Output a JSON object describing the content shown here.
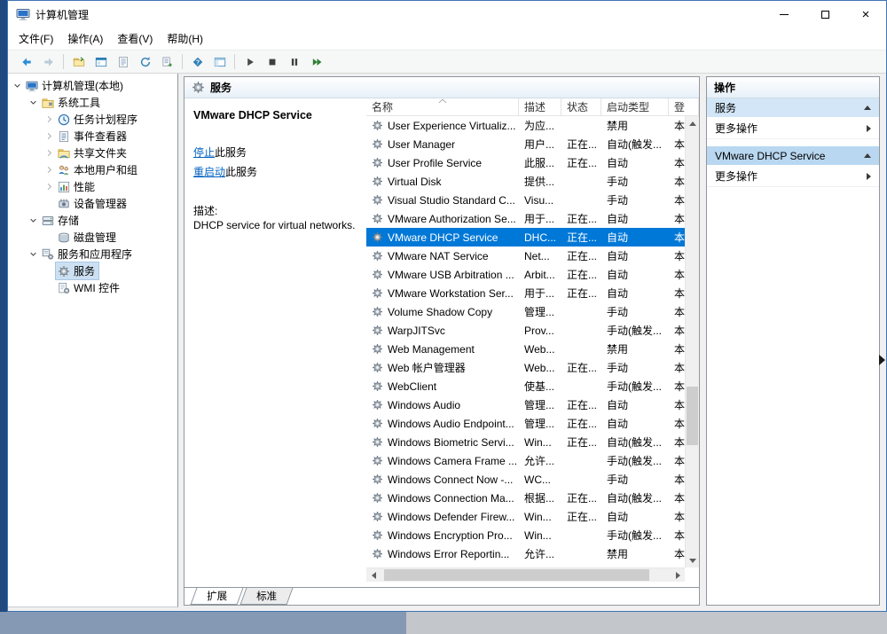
{
  "window": {
    "title": "计算机管理"
  },
  "menubar": {
    "items": [
      "文件(F)",
      "操作(A)",
      "查看(V)",
      "帮助(H)"
    ]
  },
  "toolbar": {
    "buttons": [
      {
        "name": "back",
        "icon": "back-icon"
      },
      {
        "name": "forward",
        "icon": "forward-icon"
      },
      {
        "type": "separator"
      },
      {
        "name": "export",
        "icon": "folder-icon"
      },
      {
        "name": "console-window",
        "icon": "console-window-icon"
      },
      {
        "name": "properties",
        "icon": "properties-icon"
      },
      {
        "name": "refresh",
        "icon": "refresh-icon"
      },
      {
        "name": "export-list",
        "icon": "export-list-icon"
      },
      {
        "type": "separator"
      },
      {
        "name": "help",
        "icon": "help-icon"
      },
      {
        "name": "show-console-tree",
        "icon": "console-tree-icon"
      },
      {
        "type": "separator"
      },
      {
        "name": "start-service",
        "icon": "start-service-icon"
      },
      {
        "name": "stop-service",
        "icon": "stop-service-icon"
      },
      {
        "name": "pause-service",
        "icon": "pause-service-icon"
      },
      {
        "name": "restart-service",
        "icon": "restart-service-icon"
      }
    ]
  },
  "tree": {
    "items": [
      {
        "label": "计算机管理(本地)",
        "level": 0,
        "chevron": "expanded",
        "icon": "computer-icon",
        "selected": false
      },
      {
        "label": "系统工具",
        "level": 1,
        "chevron": "expanded",
        "icon": "system-tools-icon",
        "selected": false
      },
      {
        "label": "任务计划程序",
        "level": 2,
        "chevron": "collapsed",
        "icon": "task-scheduler-icon",
        "selected": false
      },
      {
        "label": "事件查看器",
        "level": 2,
        "chevron": "collapsed",
        "icon": "event-viewer-icon",
        "selected": false
      },
      {
        "label": "共享文件夹",
        "level": 2,
        "chevron": "collapsed",
        "icon": "shared-folder-icon",
        "selected": false
      },
      {
        "label": "本地用户和组",
        "level": 2,
        "chevron": "collapsed",
        "icon": "users-icon",
        "selected": false
      },
      {
        "label": "性能",
        "level": 2,
        "chevron": "collapsed",
        "icon": "performance-icon",
        "selected": false
      },
      {
        "label": "设备管理器",
        "level": 2,
        "chevron": "none",
        "icon": "device-manager-icon",
        "selected": false
      },
      {
        "label": "存储",
        "level": 1,
        "chevron": "expanded",
        "icon": "storage-icon",
        "selected": false
      },
      {
        "label": "磁盘管理",
        "level": 2,
        "chevron": "none",
        "icon": "disk-icon",
        "selected": false
      },
      {
        "label": "服务和应用程序",
        "level": 1,
        "chevron": "expanded",
        "icon": "services-apps-icon",
        "selected": false
      },
      {
        "label": "服务",
        "level": 2,
        "chevron": "none",
        "icon": "gear-icon",
        "selected": true
      },
      {
        "label": "WMI 控件",
        "level": 2,
        "chevron": "none",
        "icon": "wmi-icon",
        "selected": false
      }
    ]
  },
  "services_pane": {
    "header_title": "服务",
    "selected_service": {
      "name": "VMware DHCP Service",
      "actions": [
        {
          "link": "停止",
          "suffix": "此服务"
        },
        {
          "link": "重启动",
          "suffix": "此服务"
        }
      ],
      "description_label": "描述:",
      "description": "DHCP service for virtual networks."
    },
    "list": {
      "columns": [
        "名称",
        "描述",
        "状态",
        "启动类型",
        "登"
      ],
      "sort_column": 0,
      "rows": [
        {
          "name": "User Experience Virtualiz...",
          "desc": "为应...",
          "status": "",
          "startup": "禁用",
          "logon": "本",
          "selected": false
        },
        {
          "name": "User Manager",
          "desc": "用户...",
          "status": "正在...",
          "startup": "自动(触发...",
          "logon": "本",
          "selected": false
        },
        {
          "name": "User Profile Service",
          "desc": "此服...",
          "status": "正在...",
          "startup": "自动",
          "logon": "本",
          "selected": false
        },
        {
          "name": "Virtual Disk",
          "desc": "提供...",
          "status": "",
          "startup": "手动",
          "logon": "本",
          "selected": false
        },
        {
          "name": "Visual Studio Standard C...",
          "desc": "Visu...",
          "status": "",
          "startup": "手动",
          "logon": "本",
          "selected": false
        },
        {
          "name": "VMware Authorization Se...",
          "desc": "用于...",
          "status": "正在...",
          "startup": "自动",
          "logon": "本",
          "selected": false
        },
        {
          "name": "VMware DHCP Service",
          "desc": "DHC...",
          "status": "正在...",
          "startup": "自动",
          "logon": "本",
          "selected": true
        },
        {
          "name": "VMware NAT Service",
          "desc": "Net...",
          "status": "正在...",
          "startup": "自动",
          "logon": "本",
          "selected": false
        },
        {
          "name": "VMware USB Arbitration ...",
          "desc": "Arbit...",
          "status": "正在...",
          "startup": "自动",
          "logon": "本",
          "selected": false
        },
        {
          "name": "VMware Workstation Ser...",
          "desc": "用于...",
          "status": "正在...",
          "startup": "自动",
          "logon": "本",
          "selected": false
        },
        {
          "name": "Volume Shadow Copy",
          "desc": "管理...",
          "status": "",
          "startup": "手动",
          "logon": "本",
          "selected": false
        },
        {
          "name": "WarpJITSvc",
          "desc": "Prov...",
          "status": "",
          "startup": "手动(触发...",
          "logon": "本",
          "selected": false
        },
        {
          "name": "Web Management",
          "desc": "Web...",
          "status": "",
          "startup": "禁用",
          "logon": "本",
          "selected": false
        },
        {
          "name": "Web 帐户管理器",
          "desc": "Web...",
          "status": "正在...",
          "startup": "手动",
          "logon": "本",
          "selected": false
        },
        {
          "name": "WebClient",
          "desc": "使基...",
          "status": "",
          "startup": "手动(触发...",
          "logon": "本",
          "selected": false
        },
        {
          "name": "Windows Audio",
          "desc": "管理...",
          "status": "正在...",
          "startup": "自动",
          "logon": "本",
          "selected": false
        },
        {
          "name": "Windows Audio Endpoint...",
          "desc": "管理...",
          "status": "正在...",
          "startup": "自动",
          "logon": "本",
          "selected": false
        },
        {
          "name": "Windows Biometric Servi...",
          "desc": "Win...",
          "status": "正在...",
          "startup": "自动(触发...",
          "logon": "本",
          "selected": false
        },
        {
          "name": "Windows Camera Frame ...",
          "desc": "允许...",
          "status": "",
          "startup": "手动(触发...",
          "logon": "本",
          "selected": false
        },
        {
          "name": "Windows Connect Now -...",
          "desc": "WC...",
          "status": "",
          "startup": "手动",
          "logon": "本",
          "selected": false
        },
        {
          "name": "Windows Connection Ma...",
          "desc": "根据...",
          "status": "正在...",
          "startup": "自动(触发...",
          "logon": "本",
          "selected": false
        },
        {
          "name": "Windows Defender Firew...",
          "desc": "Win...",
          "status": "正在...",
          "startup": "自动",
          "logon": "本",
          "selected": false
        },
        {
          "name": "Windows Encryption Pro...",
          "desc": "Win...",
          "status": "",
          "startup": "手动(触发...",
          "logon": "本",
          "selected": false
        },
        {
          "name": "Windows Error Reportin...",
          "desc": "允许...",
          "status": "",
          "startup": "禁用",
          "logon": "本",
          "selected": false
        }
      ]
    },
    "tabs": [
      {
        "label": "扩展",
        "active": true
      },
      {
        "label": "标准",
        "active": false
      }
    ]
  },
  "actions_pane": {
    "header_title": "操作",
    "sections": [
      {
        "title": "服务",
        "items": [
          "更多操作"
        ]
      },
      {
        "title": "VMware DHCP Service",
        "items": [
          "更多操作"
        ]
      }
    ]
  }
}
